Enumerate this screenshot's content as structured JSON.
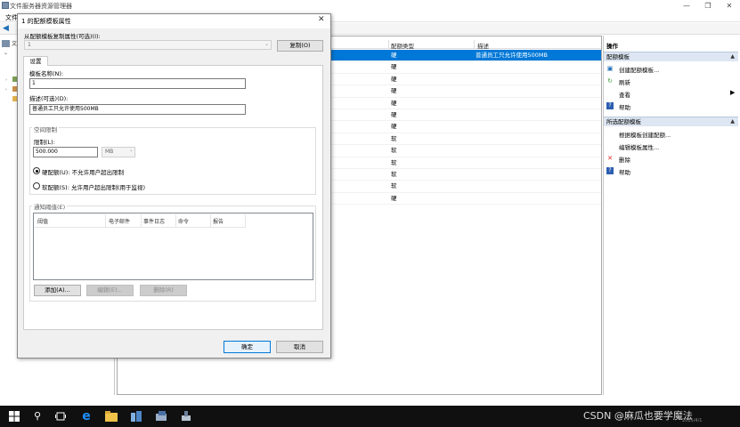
{
  "main": {
    "title": "文件服务器资源管理器",
    "menu_file": "文件",
    "tree": [
      "文",
      "",
      "",
      ""
    ]
  },
  "list": {
    "columns": [
      "配额类型",
      "描述"
    ],
    "rows": [
      {
        "type": "硬",
        "desc": "普通员工只允许使用500MB",
        "selected": true
      },
      {
        "type": "硬",
        "desc": ""
      },
      {
        "type": "硬",
        "desc": ""
      },
      {
        "type": "硬",
        "desc": ""
      },
      {
        "type": "硬",
        "desc": ""
      },
      {
        "type": "硬",
        "desc": ""
      },
      {
        "type": "硬",
        "desc": ""
      },
      {
        "type": "软",
        "desc": ""
      },
      {
        "type": "软",
        "desc": ""
      },
      {
        "type": "软",
        "desc": ""
      },
      {
        "type": "软",
        "desc": ""
      },
      {
        "type": "软",
        "desc": ""
      },
      {
        "type": "硬",
        "desc": ""
      }
    ]
  },
  "actions": {
    "title": "操作",
    "group1": "配额模板",
    "create": "创建配额模板...",
    "refresh": "刷新",
    "view": "查看",
    "help1": "帮助",
    "group2": "所选配额模板",
    "create_from": "根据模板创建配额...",
    "edit_props": "编辑模板属性...",
    "delete": "删除",
    "help2": "帮助"
  },
  "dialog": {
    "title": "1 的配额模板属性",
    "close": "✕",
    "copy_label": "从配额模板复制属性(可选)(I):",
    "copy_select": "1",
    "copy_button": "复制(O)",
    "tab": "设置",
    "name_label": "模板名称(N):",
    "name_value": "1",
    "desc_label": "描述(可选)(D):",
    "desc_value": "普通员工只允许使用500MB",
    "space_title": "空间限制",
    "limit_label": "限制(L):",
    "limit_value": "500.000",
    "unit": "MB",
    "hard_quota": "硬配额(U): 不允许用户超出限制",
    "soft_quota": "软配额(S): 允许用户超出限制(用于监视)",
    "hard_selected": true,
    "notify_title": "通知阈值(E)",
    "notify_cols": [
      "阈值",
      "电子邮件",
      "事件日志",
      "命令",
      "报告"
    ],
    "add_button": "添加(A)...",
    "edit_button": "编辑(E)...",
    "remove_button": "删除(R)",
    "ok_button": "确定",
    "cancel_button": "取消"
  },
  "taskbar": {
    "watermark": "CSDN @麻瓜也要学魔法",
    "date": "2025/4/1"
  },
  "colors": {
    "accent": "#0078d7",
    "action_group_bg": "#dde6f2"
  }
}
